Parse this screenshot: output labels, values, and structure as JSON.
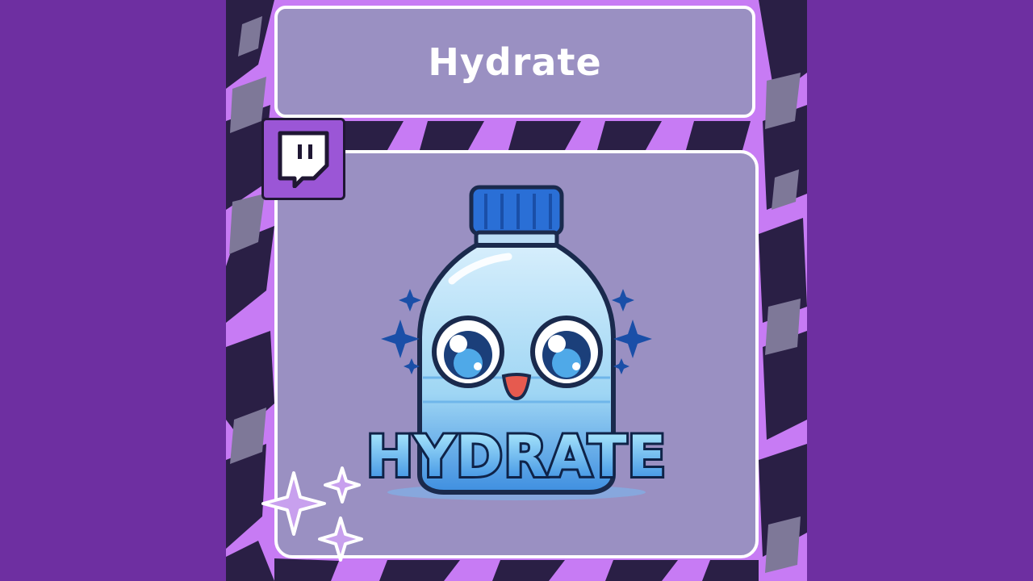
{
  "title": "Hydrate",
  "mascot": {
    "wordmark": "HYDRATE",
    "icon": "water-bottle-mascot-icon"
  },
  "badge": {
    "icon": "twitch-logo-icon"
  },
  "decor": {
    "icon": "sparkle-icon"
  },
  "colors": {
    "background": "#6e2fa1",
    "panel": "#c77bf4",
    "card": "#9a90c2",
    "card_border": "#ffffff",
    "pattern_dark": "#2a1f45",
    "pattern_mid": "#7e7898",
    "cap_blue": "#2a6fd6",
    "bottle_blue": "#9fd6f4",
    "text_white": "#ffffff",
    "badge_purple": "#9b56d6"
  }
}
